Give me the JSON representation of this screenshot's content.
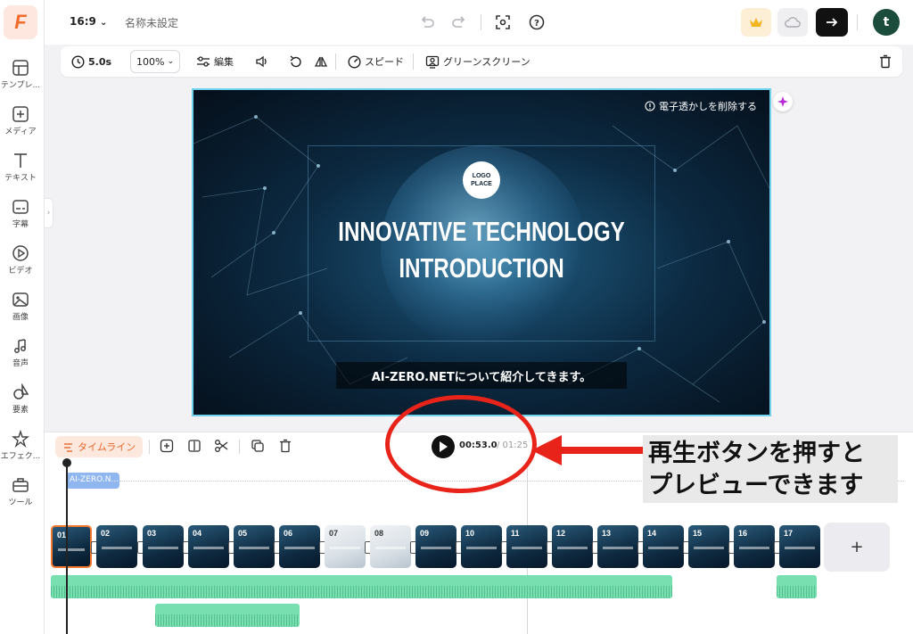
{
  "app": {
    "logo_letter": "F",
    "aspect_ratio": "16:9",
    "project_title": "名称未設定",
    "avatar_letter": "t"
  },
  "sidebar": {
    "items": [
      {
        "label": "テンプレ...",
        "icon": "template-icon"
      },
      {
        "label": "メディア",
        "icon": "media-upload-icon"
      },
      {
        "label": "テキスト",
        "icon": "text-icon"
      },
      {
        "label": "字幕",
        "icon": "subtitle-icon"
      },
      {
        "label": "ビデオ",
        "icon": "video-icon"
      },
      {
        "label": "画像",
        "icon": "image-icon"
      },
      {
        "label": "音声",
        "icon": "music-icon"
      },
      {
        "label": "要素",
        "icon": "elements-icon"
      },
      {
        "label": "エフェク...",
        "icon": "effects-icon"
      },
      {
        "label": "ツール",
        "icon": "toolbox-icon"
      }
    ]
  },
  "toolbar": {
    "duration": "5.0s",
    "zoom": "100%",
    "edit_label": "編集",
    "speed_label": "スピード",
    "greenscreen_label": "グリーンスクリーン"
  },
  "canvas": {
    "watermark_label": "電子透かしを削除する",
    "logo_placeholder_line1": "LOGO",
    "logo_placeholder_line2": "PLACE",
    "title_line1": "INNOVATIVE TECHNOLOGY",
    "title_line2": "INTRODUCTION",
    "caption": "AI-ZERO.NETについて紹介してきます。"
  },
  "timeline": {
    "tab_label": "タイムライン",
    "current_time": "00:53.0",
    "total_time": "/ 01:25",
    "text_clip_label": "AI-ZERO.N...",
    "scenes": [
      "01",
      "02",
      "03",
      "04",
      "05",
      "06",
      "07",
      "08",
      "09",
      "10",
      "11",
      "12",
      "13",
      "14",
      "15",
      "16",
      "17"
    ],
    "add_scene_label": "+"
  },
  "annotation": {
    "line1": "再生ボタンを押すと",
    "line2": "プレビューできます",
    "color": "#e8241a"
  },
  "colors": {
    "accent": "#f26b2d",
    "canvas_border": "#6fd3ee",
    "audio_track": "#77dfb0",
    "text_clip": "#8fb6ef"
  }
}
